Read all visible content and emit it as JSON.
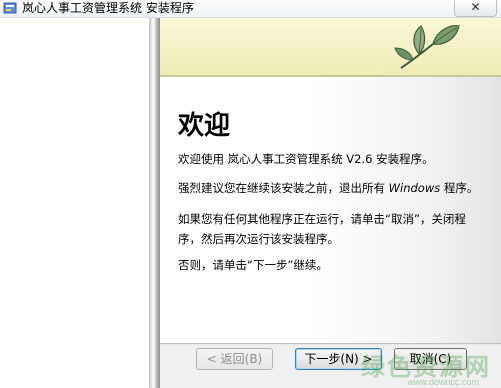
{
  "window": {
    "title": "岚心人事工资管理系统 安装程序",
    "close_label": "✕"
  },
  "content": {
    "heading": "欢迎",
    "p1": "欢迎使用 岚心人事工资管理系统 V2.6 安装程序。",
    "p2_a": "强烈建议您在继续该安装之前，退出所有 ",
    "p2_windows": "Windows",
    "p2_b": " 程序。",
    "p3_line1": "如果您有任何其他程序正在运行，请单击“取消”，关闭程",
    "p3_line2": "序，然后再次运行该安装程序。",
    "p4": "否则，请单击“下一步”继续。"
  },
  "buttons": {
    "back": "< 返回(B)",
    "next": "下一步(N) >",
    "cancel": "取消(C)"
  },
  "watermark": {
    "text": "绿色资源网",
    "url": "www.downcc.com"
  }
}
